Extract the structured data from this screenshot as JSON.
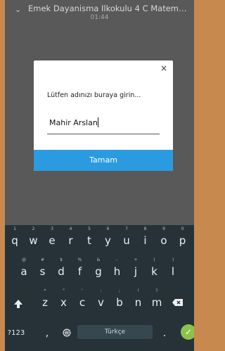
{
  "header": {
    "title": "Emek Dayanisma Ilkokulu 4 C Matemati...",
    "time": "01:44"
  },
  "dialog": {
    "close_symbol": "×",
    "prompt": "Lütfen adınızı buraya girin...",
    "input_value": "Mahir Arslan",
    "ok_label": "Tamam"
  },
  "keyboard": {
    "row1": [
      {
        "char": "q",
        "hint": "1"
      },
      {
        "char": "w",
        "hint": "2"
      },
      {
        "char": "e",
        "hint": "3"
      },
      {
        "char": "r",
        "hint": "4"
      },
      {
        "char": "t",
        "hint": "5"
      },
      {
        "char": "y",
        "hint": "6"
      },
      {
        "char": "u",
        "hint": "7"
      },
      {
        "char": "i",
        "hint": "8"
      },
      {
        "char": "o",
        "hint": "9"
      },
      {
        "char": "p",
        "hint": "0"
      }
    ],
    "row2": [
      {
        "char": "a",
        "hint": "@"
      },
      {
        "char": "s",
        "hint": "#"
      },
      {
        "char": "d",
        "hint": "$"
      },
      {
        "char": "f",
        "hint": "%"
      },
      {
        "char": "g",
        "hint": "&"
      },
      {
        "char": "h",
        "hint": "-"
      },
      {
        "char": "j",
        "hint": "+"
      },
      {
        "char": "k",
        "hint": "("
      },
      {
        "char": "l",
        "hint": ")"
      }
    ],
    "row3": [
      {
        "char": "z",
        "hint": "*"
      },
      {
        "char": "x",
        "hint": "\""
      },
      {
        "char": "c",
        "hint": "'"
      },
      {
        "char": "v",
        "hint": ":"
      },
      {
        "char": "b",
        "hint": ";"
      },
      {
        "char": "n",
        "hint": "!"
      },
      {
        "char": "m",
        "hint": "?"
      }
    ],
    "symbols_label": "?123",
    "comma": ",",
    "globe_icon": "globe-icon",
    "space_label": "Türkçe",
    "period": ".",
    "enter_icon": "check-icon",
    "shift_icon": "shift-icon",
    "backspace_icon": "backspace-icon"
  }
}
